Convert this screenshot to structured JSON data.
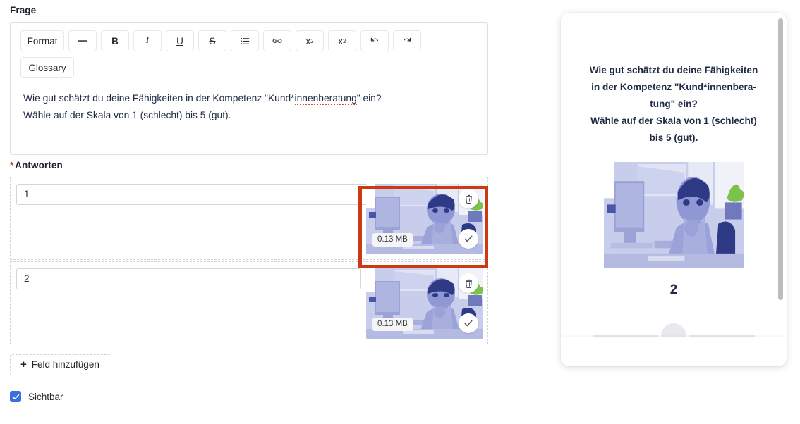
{
  "question_section": {
    "label": "Frage",
    "toolbar": [
      {
        "name": "format-button",
        "label": "Format",
        "kind": "text",
        "wide": true
      },
      {
        "name": "horizontal-rule-icon",
        "label": "—",
        "kind": "icon"
      },
      {
        "name": "bold-icon",
        "label": "B",
        "kind": "bold"
      },
      {
        "name": "italic-icon",
        "label": "I",
        "kind": "italic"
      },
      {
        "name": "underline-icon",
        "label": "U",
        "kind": "underline"
      },
      {
        "name": "strikethrough-icon",
        "label": "S",
        "kind": "strike"
      },
      {
        "name": "bullet-list-icon",
        "label": "list",
        "kind": "list"
      },
      {
        "name": "link-icon",
        "label": "link",
        "kind": "link"
      },
      {
        "name": "superscript-icon",
        "label": "x",
        "sup": "2",
        "kind": "sup"
      },
      {
        "name": "subscript-icon",
        "label": "x",
        "sub": "2",
        "kind": "sub"
      },
      {
        "name": "undo-icon",
        "label": "undo",
        "kind": "undo"
      },
      {
        "name": "redo-icon",
        "label": "redo",
        "kind": "redo"
      }
    ],
    "glossary_label": "Glossary",
    "body_line1_before": "Wie gut schätzt du deine Fähigkeiten in der Kompetenz \"Kund*",
    "body_line1_misspelled": "innenberatung",
    "body_line1_after": "\" ein?",
    "body_line2": "Wähle auf der Skala von 1 (schlecht) bis 5 (gut)."
  },
  "answers_section": {
    "label": "Antworten",
    "required_marker": "*",
    "rows": [
      {
        "value": "1",
        "file_size": "0.13 MB",
        "delete_icon": "trash-icon",
        "confirm_icon": "check-icon",
        "highlighted": true
      },
      {
        "value": "2",
        "file_size": "0.13 MB",
        "delete_icon": "trash-icon",
        "confirm_icon": "check-icon",
        "highlighted": false
      }
    ],
    "add_field_label": "Feld hinzufügen",
    "add_field_plus": "+"
  },
  "visibility": {
    "label": "Sichtbar",
    "checked": true,
    "check_glyph": "✓"
  },
  "preview": {
    "question_line1": "Wie gut schätzt du deine Fähigkeiten",
    "question_line2": "in der Kompetenz \"Kund*innenbera-",
    "question_line3": "tung\" ein?",
    "question_line4": "Wähle auf der Skala von 1 (schlecht)",
    "question_line5": "bis 5 (gut).",
    "selected_value": "2",
    "image_alt": "office-worker-illustration"
  },
  "colors": {
    "highlight_red": "#cc3a14",
    "checkbox_blue": "#3b6fe0",
    "required_red": "#d93025",
    "illustration_purple": "#8f97d4",
    "preview_text_navy": "#1f2a44"
  }
}
